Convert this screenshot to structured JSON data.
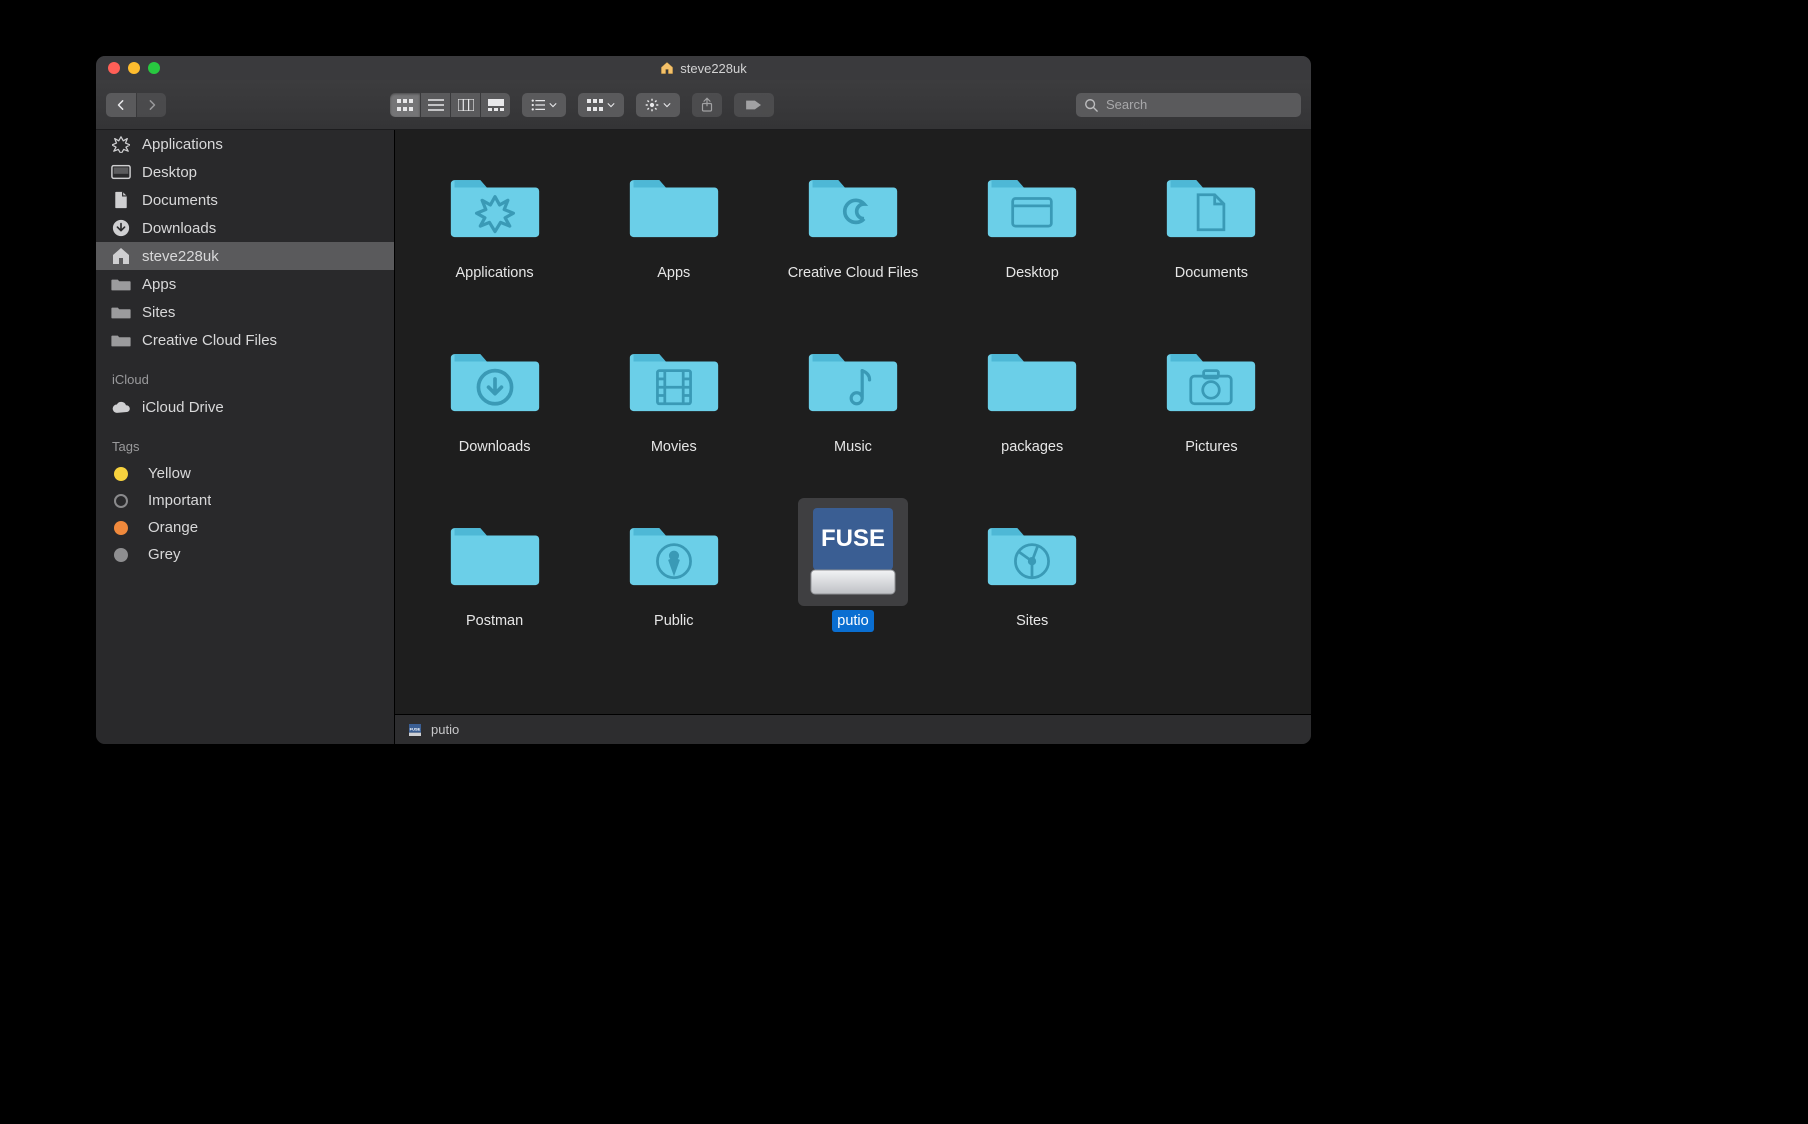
{
  "window": {
    "title": "steve228uk"
  },
  "search": {
    "placeholder": "Search",
    "value": ""
  },
  "sidebar": {
    "favorites": [
      {
        "label": "Applications",
        "icon": "apps"
      },
      {
        "label": "Desktop",
        "icon": "desktop"
      },
      {
        "label": "Documents",
        "icon": "documents"
      },
      {
        "label": "Downloads",
        "icon": "downloads"
      },
      {
        "label": "steve228uk",
        "icon": "home",
        "selected": true
      },
      {
        "label": "Apps",
        "icon": "folder"
      },
      {
        "label": "Sites",
        "icon": "folder"
      },
      {
        "label": "Creative Cloud Files",
        "icon": "folder"
      }
    ],
    "icloud_heading": "iCloud",
    "icloud": [
      {
        "label": "iCloud Drive",
        "icon": "cloud"
      }
    ],
    "tags_heading": "Tags",
    "tags": [
      {
        "label": "Yellow",
        "color": "#f7d23e"
      },
      {
        "label": "Important",
        "color": null
      },
      {
        "label": "Orange",
        "color": "#f0893c"
      },
      {
        "label": "Grey",
        "color": "#8e8e90"
      }
    ]
  },
  "items": [
    {
      "label": "Applications",
      "icon": "folder-apps"
    },
    {
      "label": "Apps",
      "icon": "folder"
    },
    {
      "label": "Creative Cloud Files",
      "icon": "folder-cc"
    },
    {
      "label": "Desktop",
      "icon": "folder-desktop"
    },
    {
      "label": "Documents",
      "icon": "folder-documents"
    },
    {
      "label": "Downloads",
      "icon": "folder-downloads"
    },
    {
      "label": "Movies",
      "icon": "folder-movies"
    },
    {
      "label": "Music",
      "icon": "folder-music"
    },
    {
      "label": "packages",
      "icon": "folder"
    },
    {
      "label": "Pictures",
      "icon": "folder-pictures"
    },
    {
      "label": "Postman",
      "icon": "folder"
    },
    {
      "label": "Public",
      "icon": "folder-public"
    },
    {
      "label": "putio",
      "icon": "fuse-drive",
      "selected": true
    },
    {
      "label": "Sites",
      "icon": "folder-sites"
    }
  ],
  "pathbar": {
    "label": "putio"
  }
}
